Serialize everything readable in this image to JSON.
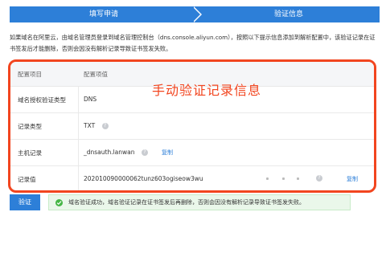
{
  "steps": {
    "step1_label": "填写申请",
    "step2_label": "验证信息"
  },
  "intro_text": "如果域名在阿里云，由域名管理员登录到域名管理控制台（dns.console.aliyun.com），按照以下提示信息添加到解析配置中，该验证记录在证书签发后才能删除，否则会因没有解析记录导致证书签发失败。",
  "overlay_title": "手动验证记录信息",
  "config": {
    "header_key": "配置项目",
    "header_value": "配置项值",
    "rows": [
      {
        "key": "域名授权验证类型",
        "value": "DNS"
      },
      {
        "key": "记录类型",
        "value": "TXT"
      },
      {
        "key": "主机记录",
        "value": "_dnsauth.lanwan",
        "copy": "复制"
      },
      {
        "key": "记录值",
        "value": "202010090000062tunz603ogiseow3wu",
        "copy": "复制"
      }
    ]
  },
  "verify_button": "验证",
  "success_message": "域名验证成功，域名验证记录在证书签发后再删除，否则会因没有解析记录导致证书签发失败。",
  "colors": {
    "primary": "#2d7fd8",
    "highlight": "#f2451f",
    "success": "#46b646"
  }
}
